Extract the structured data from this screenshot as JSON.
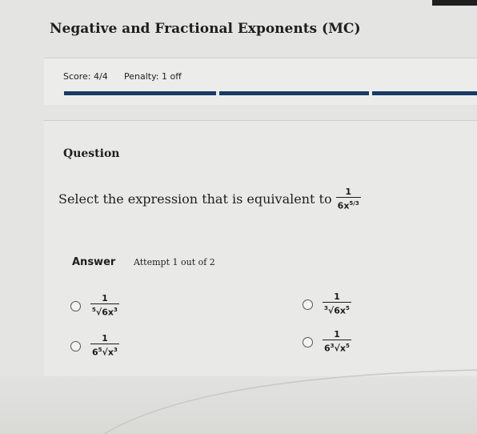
{
  "title": "Negative and Fractional Exponents (MC)",
  "score": "Score: 4/4",
  "penalty": "Penalty: 1 off",
  "progress_segments": 3,
  "question_heading": "Question",
  "prompt_text": "Select the expression that is equivalent to",
  "prompt_fraction": {
    "numerator": "1",
    "denominator_base": "6x",
    "exponent": "5/3"
  },
  "answer_label": "Answer",
  "attempt_text": "Attempt 1 out of 2",
  "options": [
    {
      "numerator": "1",
      "root_index": "5",
      "radicand": "6x",
      "radicand_exp": "3"
    },
    {
      "numerator": "1",
      "root_index": "3",
      "radicand": "6x",
      "radicand_exp": "5"
    },
    {
      "numerator": "1",
      "coefficient": "6",
      "root_index": "5",
      "radicand": "x",
      "radicand_exp": "3"
    },
    {
      "numerator": "1",
      "coefficient": "6",
      "root_index": "3",
      "radicand": "x",
      "radicand_exp": "5"
    }
  ]
}
